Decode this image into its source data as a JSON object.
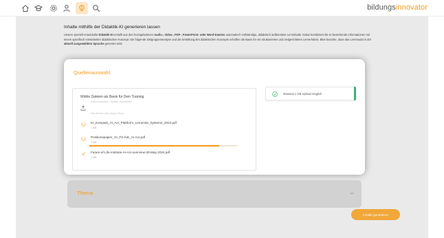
{
  "topbar": {
    "nav": [
      {
        "name": "home-icon"
      },
      {
        "name": "graduation-cap-icon"
      },
      {
        "name": "gear-icon"
      },
      {
        "name": "user-icon"
      },
      {
        "name": "bulb-icon"
      },
      {
        "name": "search-icon"
      }
    ],
    "brand_part1": "bildungs",
    "brand_part2": "innovator"
  },
  "page": {
    "title": "Inhalte mithilfe der Didaktik-KI generieren lassen",
    "intro": "Unsere speziell entwickelte Didaktik-KI erstellt aus den hochgeladenen Audio-, Video-, PDF-, PowerPoint- oder Word-Dateien automatisch vollständige, didaktisch aufbereitete Lerninhalte. Dabei kombiniert die KI bestehende Informationen mit einem spezifisch entwickelten didaktischen Konzept. Die folgende Zielgruppenanalyse und die Erstellung des didaktischen Konzepts schaffen die Basis für ein strukturiertes und zielgerichtetes Lernerlebnis. Bitte beachte, dass das Lernmodul in der aktuell ausgewählten Sprache generiert wird."
  },
  "source": {
    "title": "Quellenauswahl",
    "upload_label": "Wähle Dateien als Basis für Dein Training",
    "upload_hint": "Datei hochladen / Dateien auswählen",
    "drop_hint": "Hier klicken oder Drag & Drop",
    "files": [
      {
        "name": "KI_Kompakt_AI_Act_Plattform_Lernende_Systeme_2024.pdf",
        "size": "1 MB",
        "status": "uploading",
        "progress": null
      },
      {
        "name": "Positionspapier_GI_FG-fuE_AI-Act.pdf",
        "size": "1 MB",
        "status": "uploading",
        "progress": 0.88
      },
      {
        "name": "Future-of-Life-Institute-AI-Act-overview-30-May-2024.pdf",
        "size": "1 MB",
        "status": "done",
        "progress": null
      }
    ],
    "notice": "Maximal 1 GB Upload möglich"
  },
  "theme": {
    "title": "Thema"
  },
  "actions": {
    "next_label": "Inhalte generieren"
  },
  "colors": {
    "accent": "#f39c1b",
    "success": "#3cb371",
    "content_bg": "#eaeaea",
    "accordion_bg": "#d2d2d2"
  }
}
